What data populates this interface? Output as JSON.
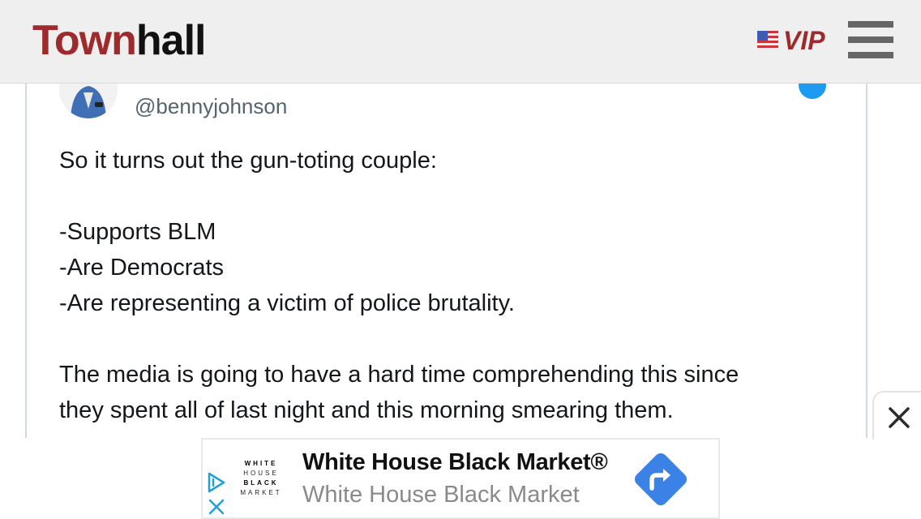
{
  "header": {
    "logo_part1": "Town",
    "logo_part2": "hall",
    "vip_label": "VIP",
    "colors": {
      "brand_red": "#9e2a2b",
      "header_bg": "#efefef",
      "menu_gray": "#666666"
    }
  },
  "tweet": {
    "handle": "@bennyjohnson",
    "lines": [
      "So it turns out the gun-toting couple:",
      "",
      "-Supports BLM",
      "-Are Democrats",
      "-Are representing a victim of police brutality.",
      "",
      "The media is going to have a hard time comprehending this since",
      "they spent all of last night and this morning smearing them."
    ],
    "colors": {
      "text": "#14171a",
      "handle": "#536471",
      "link": "#1b95e0"
    }
  },
  "ad": {
    "brand_logo_lines": [
      "WHITE",
      "HOUSE",
      "BLACK",
      "MARKET"
    ],
    "title": "White House Black Market®",
    "subtitle": "White House Black Market",
    "icons": {
      "adchoices": "adchoices-icon",
      "close": "close-icon",
      "directions": "directions-icon",
      "dismiss": "close-icon"
    },
    "colors": {
      "direction_blue": "#3b82e6",
      "adchoices_blue": "#21a0d8"
    }
  }
}
